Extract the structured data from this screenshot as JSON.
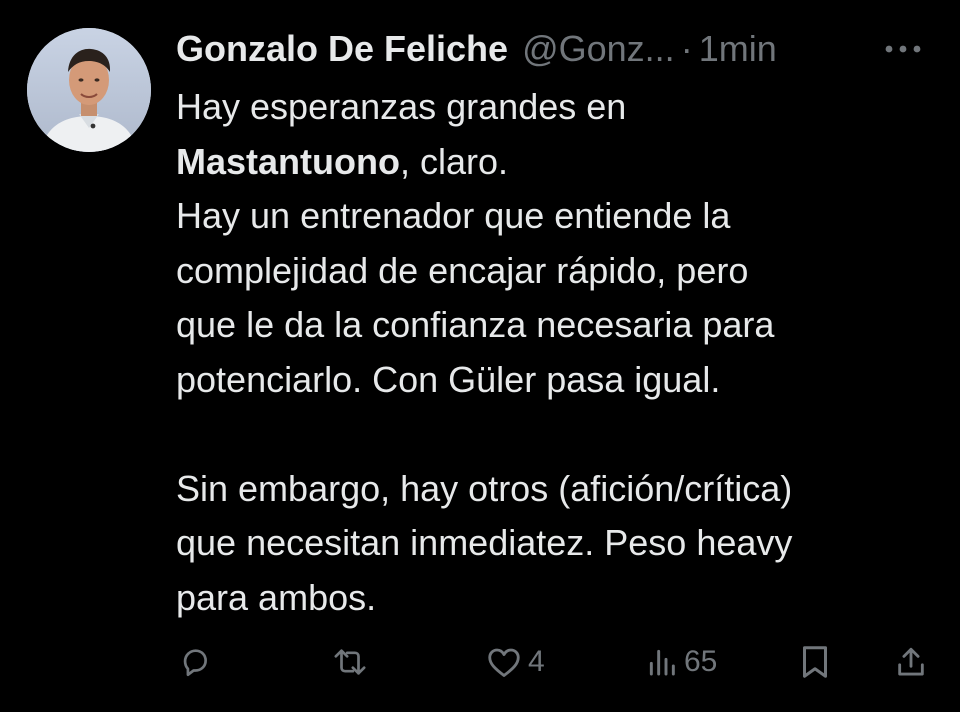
{
  "tweet": {
    "author_name": "Gonzalo De Feliche",
    "handle": "@Gonz...",
    "separator": "·",
    "time": "1min",
    "lines": {
      "l1": "Hay esperanzas grandes en",
      "l2_bold": "Mastantuono",
      "l2_rest": ", claro.",
      "l3": "Hay un entrenador que entiende la",
      "l4": "complejidad de encajar rápido, pero",
      "l5": "que le da la confianza necesaria para",
      "l6": "potenciarlo. Con Güler pasa igual.",
      "l8": "Sin embargo, hay otros (afición/crítica)",
      "l9": "que necesitan inmediatez. Peso heavy",
      "l10": "para ambos."
    }
  },
  "actions": {
    "reply_icon": "reply-icon",
    "retweet_icon": "retweet-icon",
    "like_icon": "heart-icon",
    "like_count": "4",
    "views_icon": "views-icon",
    "views_count": "65",
    "bookmark_icon": "bookmark-icon",
    "share_icon": "share-icon"
  },
  "colors": {
    "background": "#000000",
    "text": "#e7e9ea",
    "muted": "#71767b"
  }
}
